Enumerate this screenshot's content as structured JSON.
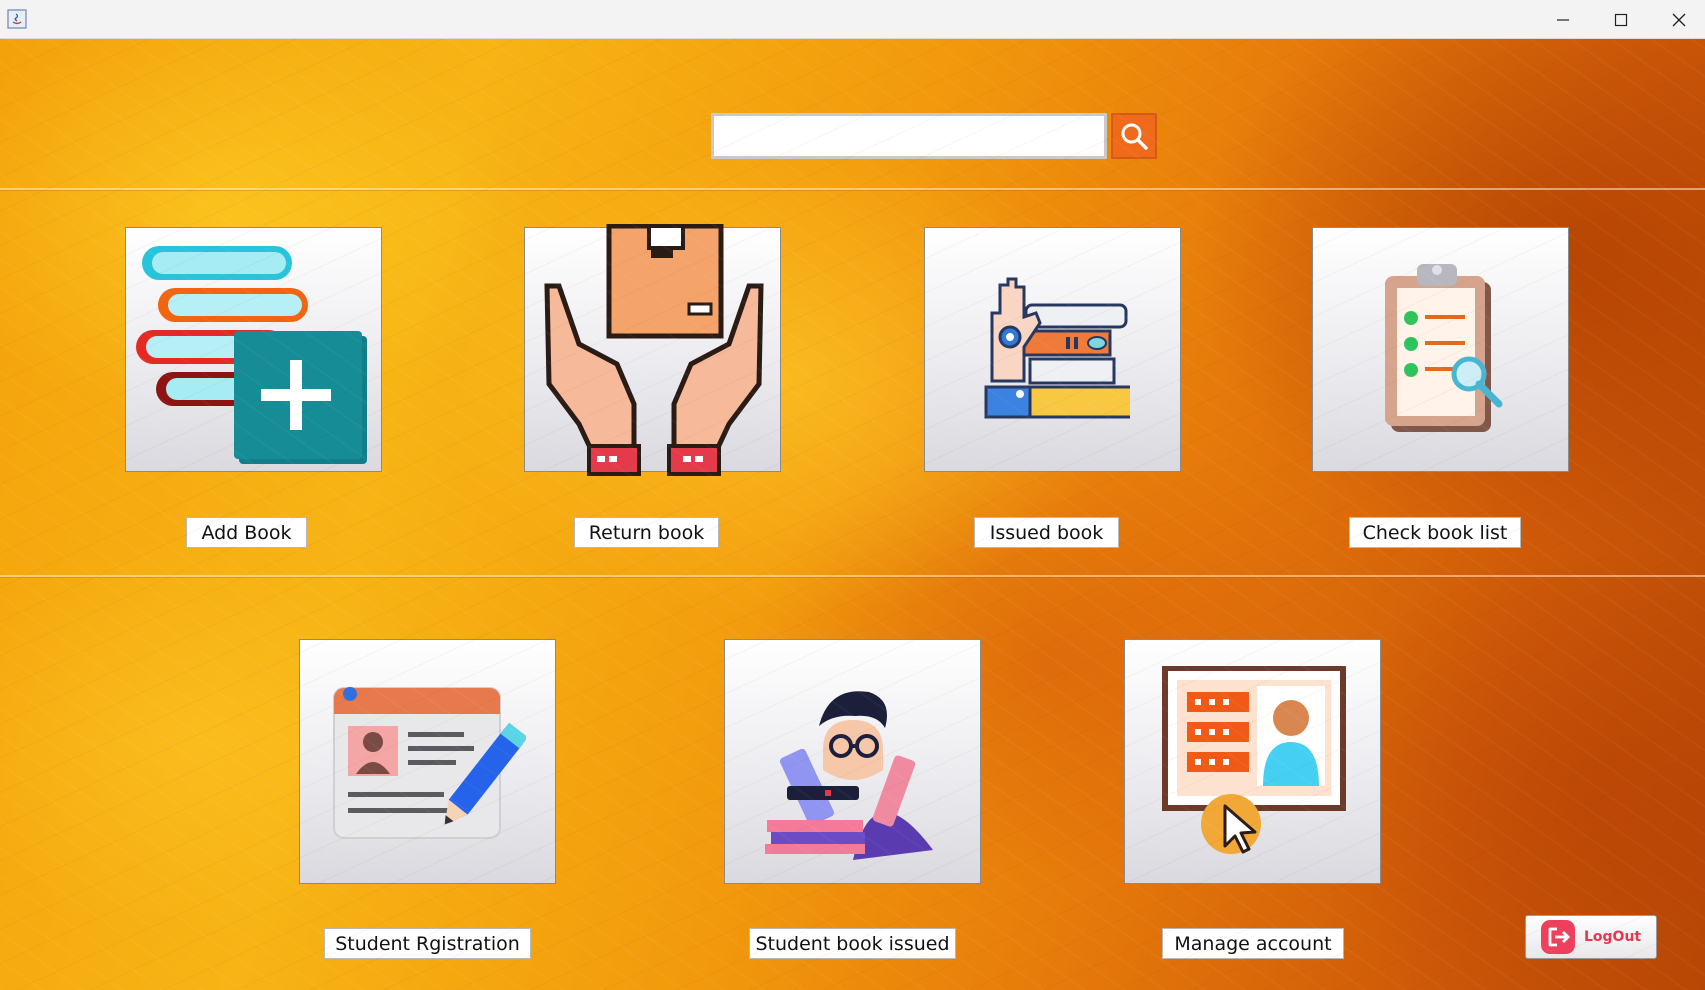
{
  "window": {
    "title": "",
    "controls": [
      "minimize",
      "maximize",
      "close"
    ]
  },
  "search": {
    "value": "",
    "placeholder": "",
    "button_icon": "search-icon"
  },
  "tiles_row1": [
    {
      "label": "Add Book",
      "icon": "books-add-icon"
    },
    {
      "label": "Return book",
      "icon": "hands-box-icon"
    },
    {
      "label": "Issued book",
      "icon": "hand-books-gear-icon"
    },
    {
      "label": "Check book list",
      "icon": "clipboard-search-icon"
    }
  ],
  "tiles_row2": [
    {
      "label": "Student Rgistration",
      "icon": "id-card-edit-icon"
    },
    {
      "label": "Student book issued",
      "icon": "student-books-icon"
    },
    {
      "label": "Manage account",
      "icon": "account-board-icon"
    }
  ],
  "logout": {
    "label": "LogOut",
    "icon": "logout-icon"
  },
  "colors": {
    "search_button": "#f06a1c",
    "logout_text": "#e8364e",
    "background": "#f2a00e"
  }
}
